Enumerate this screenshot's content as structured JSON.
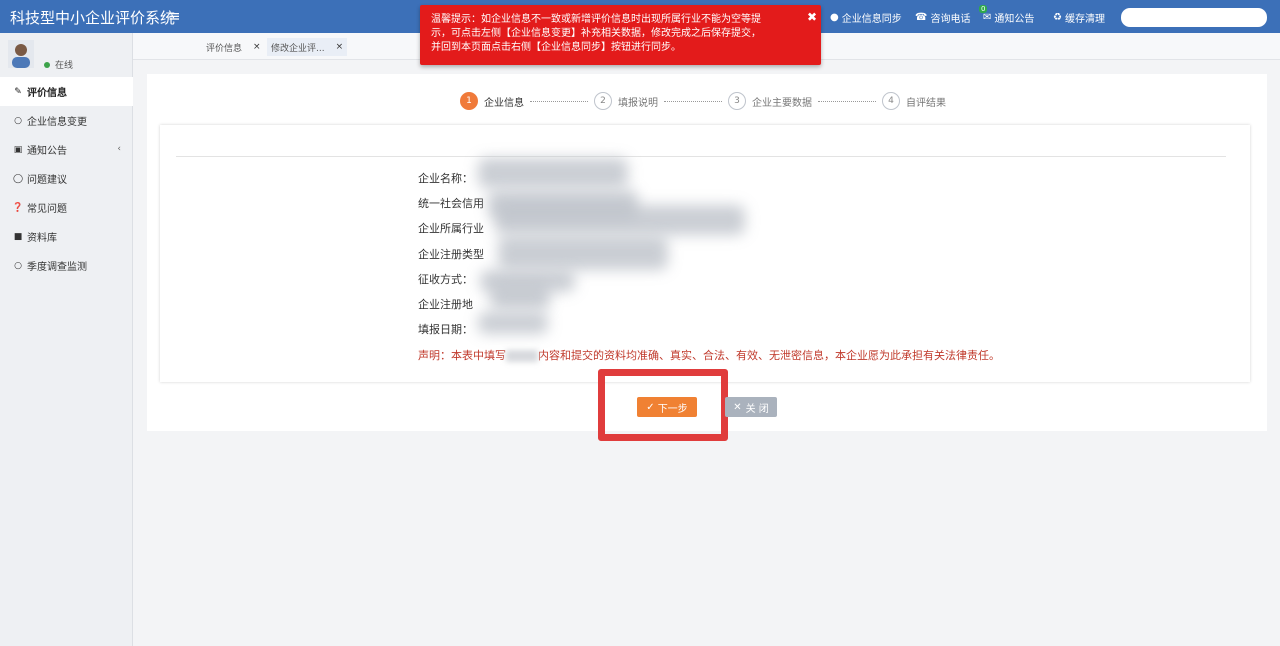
{
  "app": {
    "title": "科技型中小企业评价系统",
    "menu_icon": "≡"
  },
  "topbar": {
    "links": [
      {
        "label": "企业信息同步",
        "icon": "user-icon"
      },
      {
        "label": "咨询电话",
        "icon": "phone-icon"
      },
      {
        "label": "通知公告",
        "icon": "envelope-icon",
        "badge": "0"
      },
      {
        "label": "缓存清理",
        "icon": "recycle-icon"
      }
    ]
  },
  "toast": {
    "text": "温馨提示：如企业信息不一致或新增评价信息时出现所属行业不能为空等提示，可点击左侧【企业信息变更】补充相关数据，修改完成之后保存提交，并回到本页面点击右侧【企业信息同步】按钮进行同步。",
    "line1": "温馨提示：如企业信息不一致或新增评价信息时出现所属行业不能为空等提",
    "line2": "示，可点击左侧【企业信息变更】补充相关数据，修改完成之后保存提交，",
    "line3": "并回到本页面点击右侧【企业信息同步】按钮进行同步。",
    "close": "✖"
  },
  "user": {
    "status": "在线"
  },
  "sidebar": {
    "items": [
      {
        "label": "评价信息",
        "icon": "edit-icon",
        "active": true
      },
      {
        "label": "企业信息变更",
        "icon": "circle-icon"
      },
      {
        "label": "通知公告",
        "icon": "inbox-icon",
        "caret": "‹"
      },
      {
        "label": "问题建议",
        "icon": "comment-icon"
      },
      {
        "label": "常见问题",
        "icon": "question-icon"
      },
      {
        "label": "资料库",
        "icon": "folder-icon"
      },
      {
        "label": "季度调查监测",
        "icon": "circle-icon"
      }
    ]
  },
  "tabs": [
    {
      "label": "评价信息",
      "close": "×"
    },
    {
      "label": "修改企业评...",
      "close": "×"
    }
  ],
  "steps": [
    {
      "num": "1",
      "label": "企业信息",
      "current": true
    },
    {
      "num": "2",
      "label": "填报说明"
    },
    {
      "num": "3",
      "label": "企业主要数据"
    },
    {
      "num": "4",
      "label": "自评结果"
    }
  ],
  "form": {
    "fields": [
      {
        "label": "企业名称："
      },
      {
        "label": "统一社会信用"
      },
      {
        "label": "企业所属行业"
      },
      {
        "label": "企业注册类型"
      },
      {
        "label": "征收方式："
      },
      {
        "label": "企业注册地"
      },
      {
        "label": "填报日期："
      }
    ],
    "declaration_prefix": "声明：本表中填写",
    "declaration_suffix": "内容和提交的资料均准确、真实、合法、有效、无泄密信息，本企业愿为此承担有关法律责任。"
  },
  "buttons": {
    "next": "下一步",
    "close": "关 闭"
  }
}
